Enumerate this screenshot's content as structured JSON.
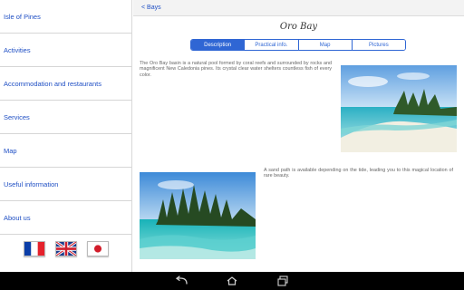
{
  "sidebar": {
    "items": [
      {
        "label": "Isle of Pines"
      },
      {
        "label": "Activities"
      },
      {
        "label": "Accommodation and restaurants"
      },
      {
        "label": "Services"
      },
      {
        "label": "Map"
      },
      {
        "label": "Useful information"
      },
      {
        "label": "About us"
      }
    ],
    "flags": [
      {
        "icon": "france-flag-icon"
      },
      {
        "icon": "uk-flag-icon"
      },
      {
        "icon": "japan-flag-icon"
      }
    ]
  },
  "header": {
    "back_label": "< Bays"
  },
  "page": {
    "title": "Oro Bay",
    "tabs": [
      {
        "label": "Description",
        "active": true
      },
      {
        "label": "Practical info."
      },
      {
        "label": "Map"
      },
      {
        "label": "Pictures"
      }
    ],
    "paragraph1": "The Oro Bay basin is a natural pool formed by coral reefs and surrounded by rocks and magnificent New Caledonia pines. Its crystal clear water shelters countless fish of every color.",
    "paragraph2": "A sand path is available depending on the tide, leading you to this magical location of rare beauty."
  },
  "system_bar": {
    "icons": [
      "back-icon",
      "home-icon",
      "recent-apps-icon"
    ]
  },
  "colors": {
    "accent": "#2f66d4",
    "link": "#1f4fc4",
    "body_text": "#666666"
  }
}
